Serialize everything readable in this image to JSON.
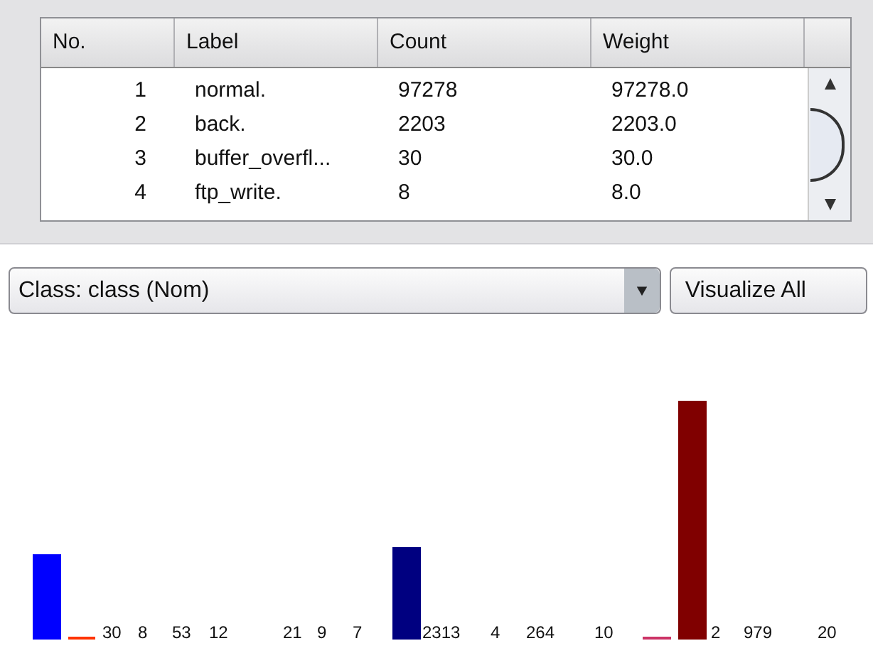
{
  "table": {
    "columns": [
      "No.",
      "Label",
      "Count",
      "Weight"
    ],
    "rows": [
      [
        "1",
        "normal.",
        "97278",
        "97278.0"
      ],
      [
        "2",
        "back.",
        "2203",
        "2203.0"
      ],
      [
        "3",
        "buffer_overfl...",
        "30",
        "30.0"
      ],
      [
        "4",
        "ftp_write.",
        "8",
        "8.0"
      ]
    ]
  },
  "class_selector": {
    "value": "Class: class (Nom)"
  },
  "buttons": [
    "Visualize All"
  ],
  "histogram": {
    "bar_labels": [
      "30",
      "8",
      "53",
      "12",
      "21",
      "9",
      "7",
      "2313",
      "4",
      "264",
      "10",
      "2",
      "979",
      "20"
    ]
  }
}
